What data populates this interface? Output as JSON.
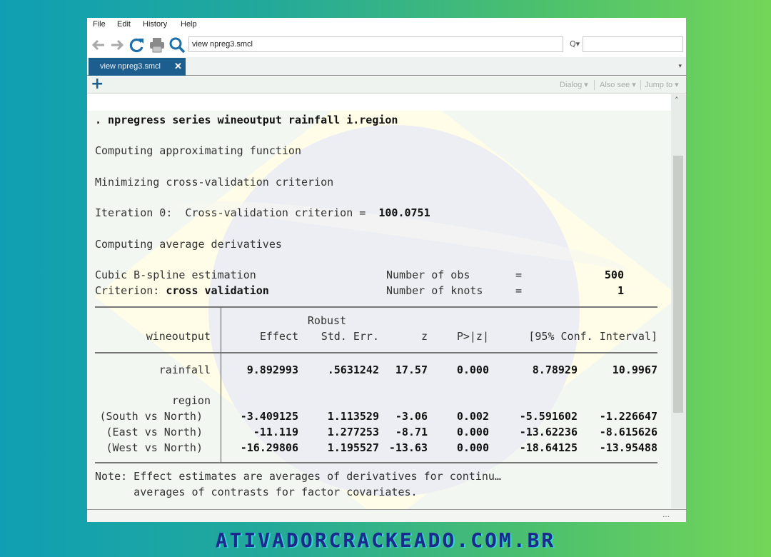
{
  "menu": [
    "File",
    "Edit",
    "History",
    "Help"
  ],
  "toolbar": {
    "icons": [
      "back-arrow-icon",
      "forward-arrow-icon",
      "refresh-icon",
      "print-icon",
      "search-icon"
    ],
    "command_value": "view npreg3.smcl",
    "find_label": "Q▾",
    "find_value": ""
  },
  "tabs": [
    {
      "label": "view npreg3.smcl",
      "close": "✕",
      "active": true
    }
  ],
  "tab_overflow": "▾",
  "viewer_bar": {
    "add": "+",
    "buttons": [
      "Dialog ▾",
      "Also see ▾",
      "Jump to ▾"
    ]
  },
  "output": {
    "command": ". npregress series wineoutput rainfall i.region",
    "lines": [
      "Computing approximating function",
      "Minimizing cross-validation criterion",
      "Iteration 0:  Cross-validation criterion =  ",
      "Computing average derivatives"
    ],
    "iteration_value": "100.0751",
    "estimation": "Cubic B-spline estimation",
    "criterion_label": "Criterion: ",
    "criterion_value": "cross validation",
    "stats": [
      {
        "label": "Number of obs",
        "eq": "=",
        "value": "500"
      },
      {
        "label": "Number of knots",
        "eq": "=",
        "value": "1"
      }
    ],
    "table": {
      "header_top": "Robust",
      "headers": [
        "wineoutput",
        "Effect",
        "Std. Err.",
        "z",
        "P>|z|",
        "[95% Conf. Interval]"
      ],
      "rows": [
        {
          "label": "rainfall",
          "values": [
            "9.892993",
            ".5631242",
            "17.57",
            "0.000",
            "8.78929",
            "10.9967"
          ]
        },
        {
          "label": "region",
          "values": []
        },
        {
          "label": "(South vs North)",
          "values": [
            "-3.409125",
            "1.113529",
            "-3.06",
            "0.002",
            "-5.591602",
            "-1.226647"
          ]
        },
        {
          "label": "(East vs North)",
          "values": [
            "-11.119",
            "1.277253",
            "-8.71",
            "0.000",
            "-13.62236",
            "-8.615626"
          ]
        },
        {
          "label": "(West vs North)",
          "values": [
            "-16.29806",
            "1.195527",
            "-13.63",
            "0.000",
            "-18.64125",
            "-13.95488"
          ]
        }
      ]
    },
    "note_line1": "Note: Effect estimates are averages of derivatives for continu…",
    "note_line2": "      averages of contrasts for factor covariates."
  },
  "scrollbar": {
    "up": "˄"
  },
  "status": "…",
  "banner": "ATIVADORCRACKEADO.COM.BR"
}
